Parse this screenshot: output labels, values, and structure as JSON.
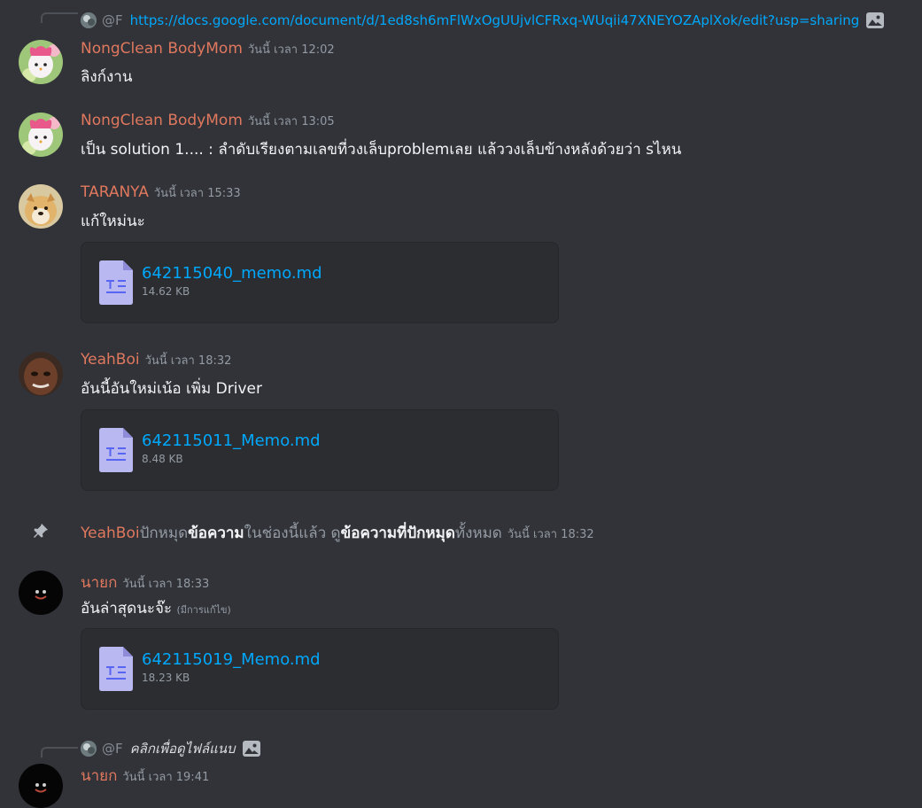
{
  "reply1": {
    "author": "@F",
    "link": "https://docs.google.com/document/d/1ed8sh6mFlWxOgUUjvlCFRxq-WUqii47XNEYOZAplXok/edit?usp=sharing"
  },
  "messages": [
    {
      "author": "NongClean BodyMom",
      "time": "วันนี้ เวลา 12:02",
      "text": "ลิงก์งาน"
    },
    {
      "author": "NongClean BodyMom",
      "time": "วันนี้ เวลา 13:05",
      "text": "เป็น solution 1.... : ลำดับเรียงตามเลขที่วงเล็บproblemเลย แล้ววงเล็บข้างหลังด้วยว่า sไหน"
    },
    {
      "author": "TARANYA",
      "time": "วันนี้ เวลา 15:33",
      "text": "แก้ใหม่นะ",
      "file": {
        "name": "642115040_memo.md",
        "size": "14.62 KB"
      }
    },
    {
      "author": "YeahBoi",
      "time": "วันนี้ เวลา 18:32",
      "text": "อันนี้อันใหม่เน้อ เพิ่ม Driver",
      "file": {
        "name": "642115011_Memo.md",
        "size": "8.48 KB"
      }
    },
    {
      "author": "นายก",
      "time": "วันนี้ เวลา 18:33",
      "text": "อันล่าสุดนะจ๊ะ",
      "edited": "(มีการแก้ไข)",
      "file": {
        "name": "642115019_Memo.md",
        "size": "18.23 KB"
      }
    },
    {
      "author": "นายก",
      "time": "วันนี้ เวลา 19:41"
    }
  ],
  "pin": {
    "user": "YeahBoi",
    "p1": "ปักหมุด",
    "b1": "ข้อความ",
    "p2": "ในช่องนี้แล้ว ดู",
    "b2": "ข้อความที่ปักหมุด",
    "p3": "ทั้งหมด",
    "time": "วันนี้ เวลา 18:32"
  },
  "reply2": {
    "author": "@F",
    "text": "คลิกเพื่อดูไฟล์แนบ"
  },
  "icons": {
    "pin": "pin-icon",
    "image": "image-icon",
    "file": "document-icon"
  }
}
